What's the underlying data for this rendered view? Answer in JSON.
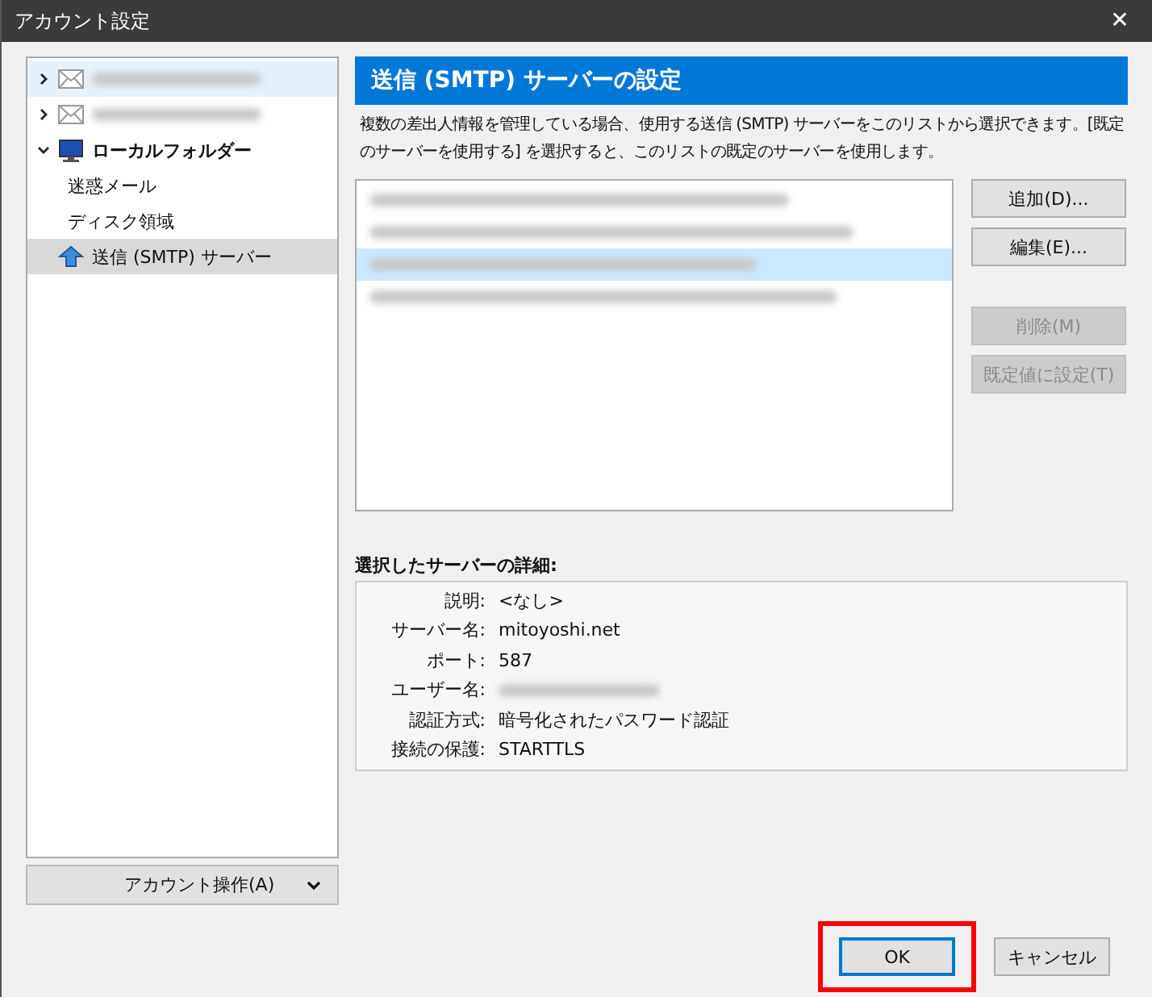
{
  "window": {
    "title": "アカウント設定",
    "close": "✕"
  },
  "tree": [
    {
      "kind": "account",
      "expanded": false,
      "selected": true,
      "redacted": true
    },
    {
      "kind": "account",
      "expanded": false,
      "selected": false,
      "redacted": true
    },
    {
      "kind": "local",
      "label": "ローカルフォルダー",
      "expanded": true,
      "selected": false,
      "children": [
        {
          "label": "迷惑メール",
          "selected": false
        },
        {
          "label": "ディスク領域",
          "selected": false
        }
      ]
    },
    {
      "kind": "smtp",
      "label": "送信 (SMTP) サーバー",
      "selected": true,
      "focused": true
    }
  ],
  "account_actions": {
    "label": "アカウント操作(A)"
  },
  "header": "送信 (SMTP) サーバーの設定",
  "description": "複数の差出人情報を管理している場合、使用する送信 (SMTP) サーバーをこのリストから選択できます。[既定のサーバーを使用する] を選択すると、このリストの既定のサーバーを使用します。",
  "servers": [
    {
      "selected": false
    },
    {
      "selected": false
    },
    {
      "selected": true
    },
    {
      "selected": false
    }
  ],
  "side_buttons": [
    {
      "label": "追加(D)...",
      "disabled": false
    },
    {
      "label": "編集(E)...",
      "disabled": false
    },
    {
      "label": "削除(M)",
      "disabled": true
    },
    {
      "label": "既定値に設定(T)",
      "disabled": true
    }
  ],
  "details": {
    "title": "選択したサーバーの詳細:",
    "rows": [
      {
        "label": "説明:",
        "value": "<なし>"
      },
      {
        "label": "サーバー名:",
        "value": "mitoyoshi.net"
      },
      {
        "label": "ポート:",
        "value": "587"
      },
      {
        "label": "ユーザー名:",
        "redacted": true
      },
      {
        "label": "認証方式:",
        "value": "暗号化されたパスワード認証"
      },
      {
        "label": "接続の保護:",
        "value": "STARTTLS"
      }
    ]
  },
  "footer_buttons": [
    {
      "label": "OK",
      "default": true,
      "highlighted": true
    },
    {
      "label": "キャンセル",
      "default": false,
      "highlighted": false
    }
  ]
}
